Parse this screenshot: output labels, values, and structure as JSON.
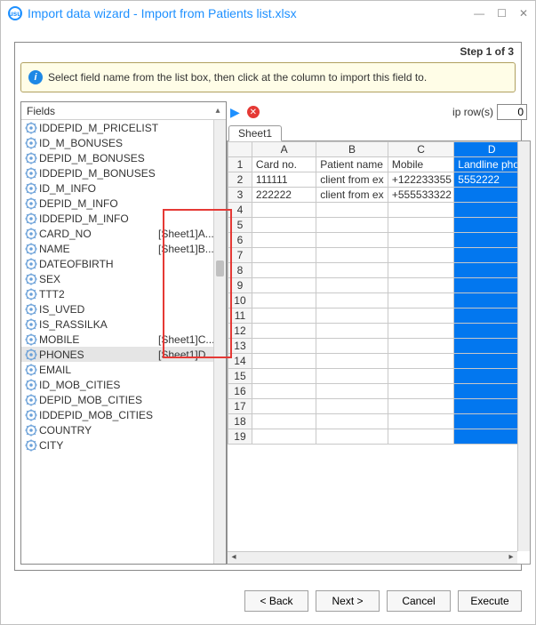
{
  "window": {
    "title": "Import data wizard - Import from Patients list.xlsx",
    "step_label": "Step 1 of 3"
  },
  "info": {
    "text": "Select field name from the list box, then click at the column to import this field to."
  },
  "fields_panel": {
    "header": "Fields",
    "items": [
      {
        "name": "IDDEPID_M_PRICELIST",
        "mapping": ""
      },
      {
        "name": "ID_M_BONUSES",
        "mapping": ""
      },
      {
        "name": "DEPID_M_BONUSES",
        "mapping": ""
      },
      {
        "name": "IDDEPID_M_BONUSES",
        "mapping": ""
      },
      {
        "name": "ID_M_INFO",
        "mapping": ""
      },
      {
        "name": "DEPID_M_INFO",
        "mapping": ""
      },
      {
        "name": "IDDEPID_M_INFO",
        "mapping": ""
      },
      {
        "name": "CARD_NO",
        "mapping": "[Sheet1]A..."
      },
      {
        "name": "NAME",
        "mapping": "[Sheet1]B..."
      },
      {
        "name": "DATEOFBIRTH",
        "mapping": ""
      },
      {
        "name": "SEX",
        "mapping": ""
      },
      {
        "name": "TTT2",
        "mapping": ""
      },
      {
        "name": "IS_UVED",
        "mapping": ""
      },
      {
        "name": "IS_RASSILKA",
        "mapping": ""
      },
      {
        "name": "MOBILE",
        "mapping": "[Sheet1]C..."
      },
      {
        "name": "PHONES",
        "mapping": "[Sheet1]D...",
        "selected": true
      },
      {
        "name": "EMAIL",
        "mapping": ""
      },
      {
        "name": "ID_MOB_CITIES",
        "mapping": ""
      },
      {
        "name": "DEPID_MOB_CITIES",
        "mapping": ""
      },
      {
        "name": "IDDEPID_MOB_CITIES",
        "mapping": ""
      },
      {
        "name": "COUNTRY",
        "mapping": ""
      },
      {
        "name": "CITY",
        "mapping": ""
      }
    ]
  },
  "right_panel": {
    "skip_label": "ip row(s)",
    "skip_value": "0",
    "sheet_tab": "Sheet1",
    "col_headers": {
      "A": "A",
      "B": "B",
      "C": "C",
      "D": "D"
    },
    "rows": [
      {
        "n": "1",
        "A": "Card no.",
        "B": "Patient name",
        "C": "Mobile",
        "D": "Landline phon"
      },
      {
        "n": "2",
        "A": "111111",
        "B": "client from ex",
        "C": "+122233355",
        "D": "5552222"
      },
      {
        "n": "3",
        "A": "222222",
        "B": "client from ex",
        "C": "+555533322",
        "D": ""
      },
      {
        "n": "4",
        "A": "",
        "B": "",
        "C": "",
        "D": ""
      },
      {
        "n": "5",
        "A": "",
        "B": "",
        "C": "",
        "D": ""
      },
      {
        "n": "6",
        "A": "",
        "B": "",
        "C": "",
        "D": ""
      },
      {
        "n": "7",
        "A": "",
        "B": "",
        "C": "",
        "D": ""
      },
      {
        "n": "8",
        "A": "",
        "B": "",
        "C": "",
        "D": ""
      },
      {
        "n": "9",
        "A": "",
        "B": "",
        "C": "",
        "D": ""
      },
      {
        "n": "10",
        "A": "",
        "B": "",
        "C": "",
        "D": ""
      },
      {
        "n": "11",
        "A": "",
        "B": "",
        "C": "",
        "D": ""
      },
      {
        "n": "12",
        "A": "",
        "B": "",
        "C": "",
        "D": ""
      },
      {
        "n": "13",
        "A": "",
        "B": "",
        "C": "",
        "D": ""
      },
      {
        "n": "14",
        "A": "",
        "B": "",
        "C": "",
        "D": ""
      },
      {
        "n": "15",
        "A": "",
        "B": "",
        "C": "",
        "D": ""
      },
      {
        "n": "16",
        "A": "",
        "B": "",
        "C": "",
        "D": ""
      },
      {
        "n": "17",
        "A": "",
        "B": "",
        "C": "",
        "D": ""
      },
      {
        "n": "18",
        "A": "",
        "B": "",
        "C": "",
        "D": ""
      },
      {
        "n": "19",
        "A": "",
        "B": "",
        "C": "",
        "D": ""
      }
    ]
  },
  "buttons": {
    "back": "< Back",
    "next": "Next >",
    "cancel": "Cancel",
    "execute": "Execute"
  }
}
